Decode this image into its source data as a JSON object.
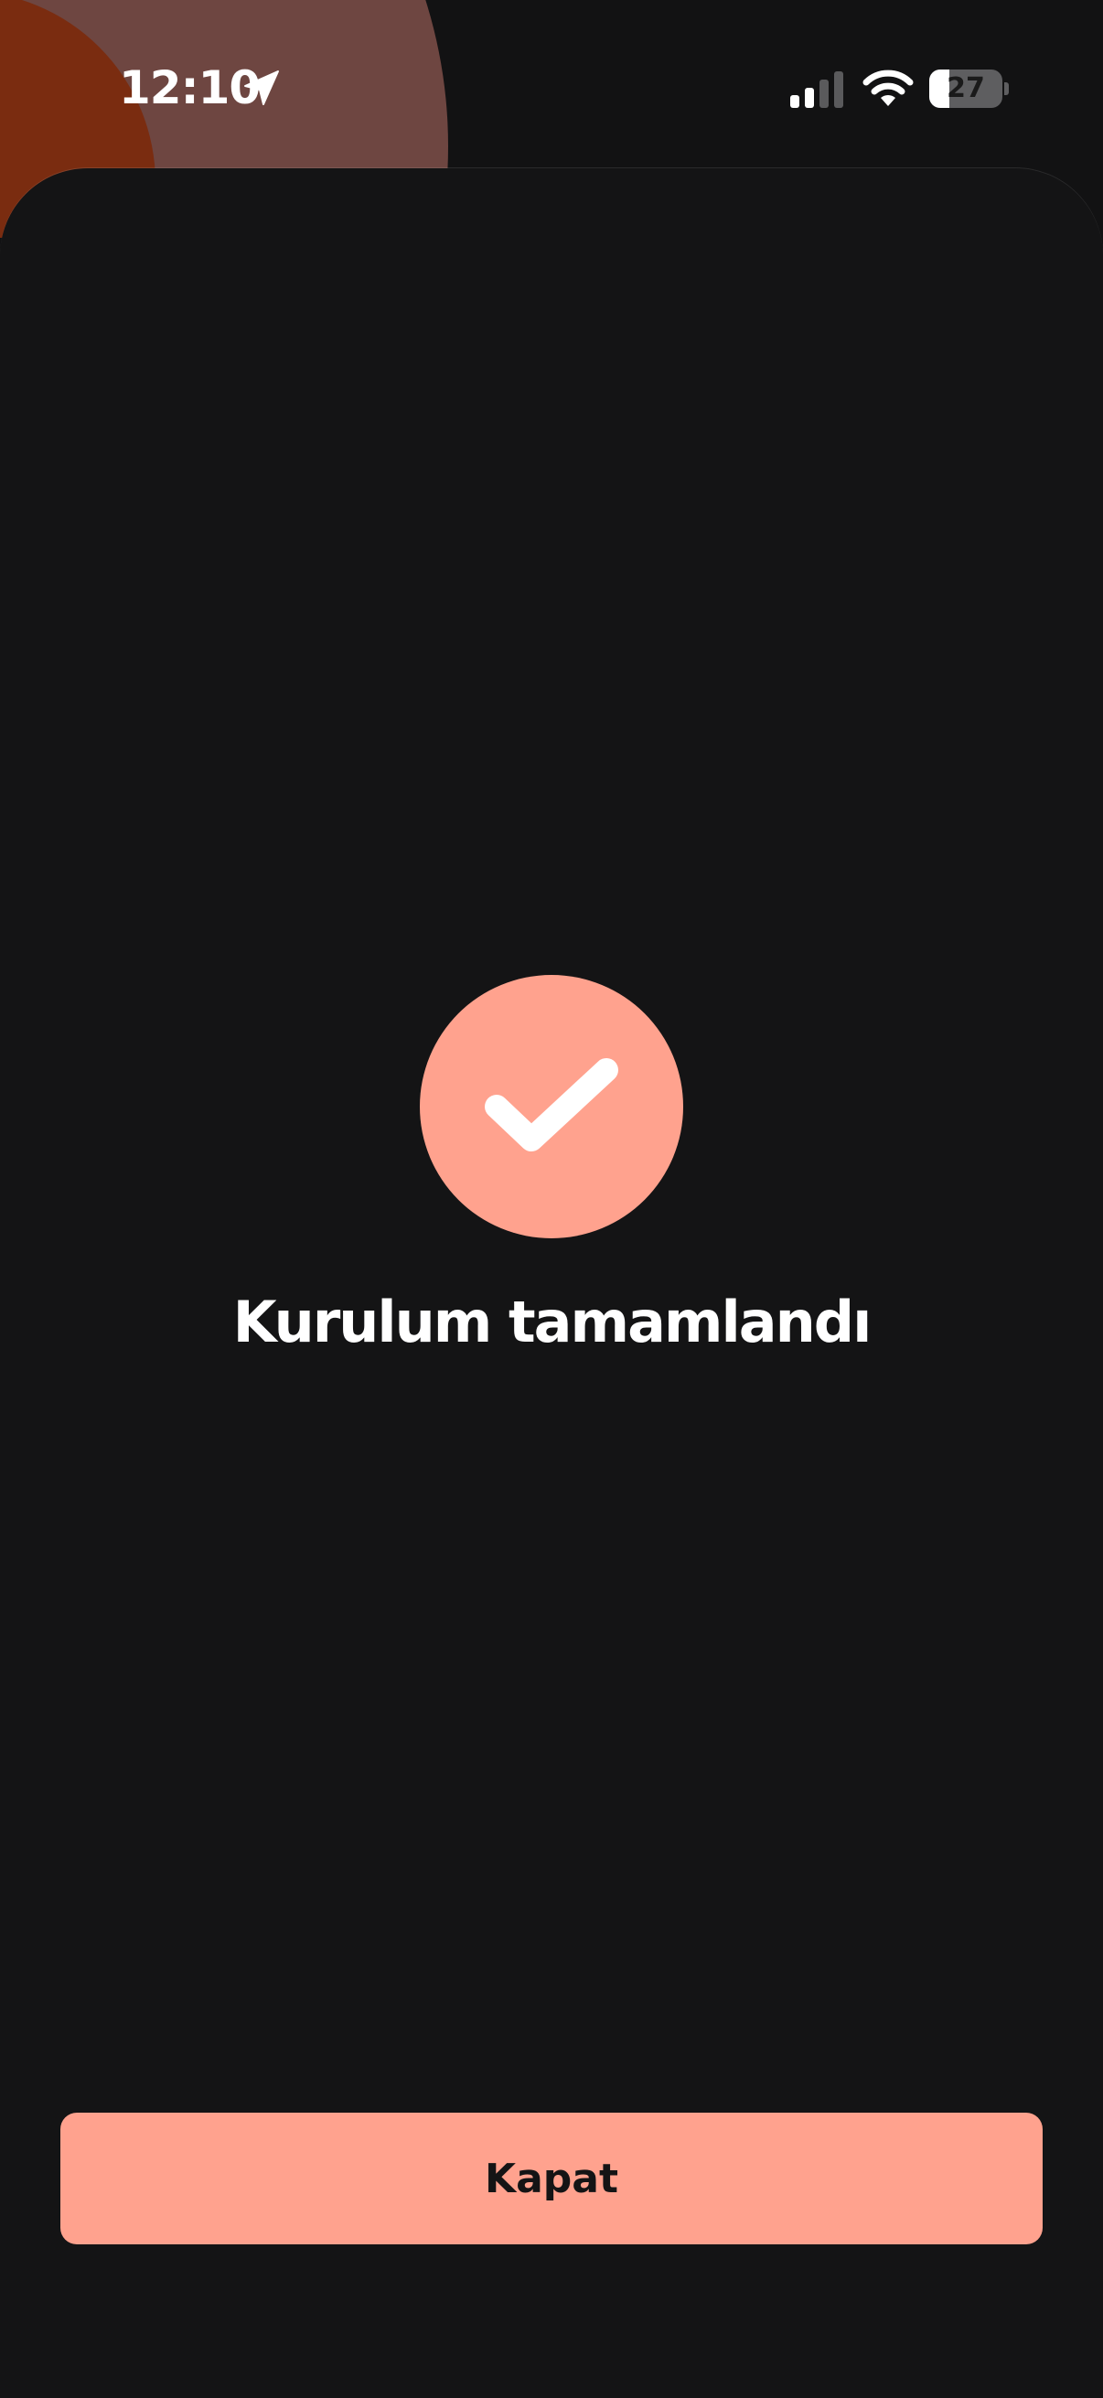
{
  "status_bar": {
    "time": "12:10",
    "battery_level": "27",
    "battery_fraction": 0.27,
    "icons": [
      "location-arrow-icon",
      "cellular-signal-icon",
      "wifi-icon",
      "battery-icon"
    ]
  },
  "sheet": {
    "status_icon": "checkmark-icon",
    "title": "Kurulum tamamlandı",
    "close_button_label": "Kapat"
  },
  "colors": {
    "accent": "#ffa28e",
    "background": "#141415",
    "art_outer": "#6e4641",
    "art_inner": "#7a2c10",
    "text_primary": "#ffffff"
  }
}
